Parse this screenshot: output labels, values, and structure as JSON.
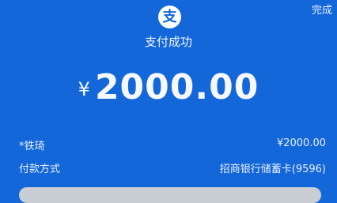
{
  "header": {
    "done_label": "完成",
    "logo_glyph": "支"
  },
  "status": {
    "title": "支付成功"
  },
  "amount": {
    "currency_symbol": "¥",
    "value": "2000.00"
  },
  "details": {
    "payee_label": "*铁琦",
    "payee_amount": "¥2000.00",
    "method_label": "付款方式",
    "method_value": "招商银行储蓄卡(9596)"
  },
  "colors": {
    "background": "#1467d8",
    "logo_bg": "#ffffff",
    "bottom_bar": "#c9cdd4"
  }
}
